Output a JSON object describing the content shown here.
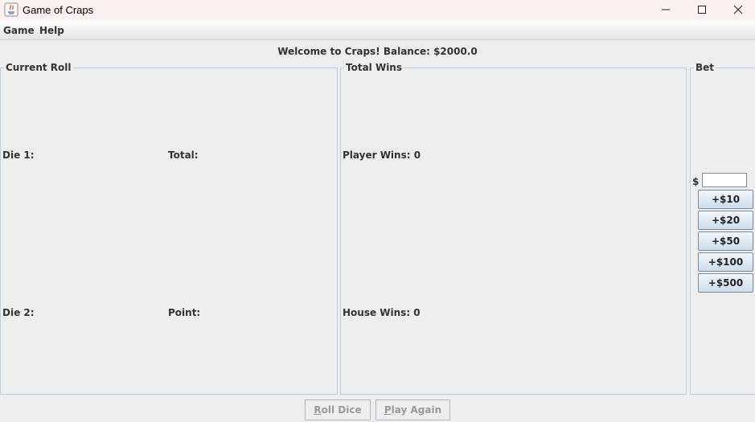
{
  "window": {
    "title": "Game of Craps",
    "icon": "java-icon"
  },
  "menu": {
    "items": [
      "Game",
      "Help"
    ]
  },
  "status": {
    "welcome": "Welcome to Craps!  Balance: $2000.0"
  },
  "current_roll": {
    "title": "Current Roll",
    "die1_label": "Die 1:",
    "die2_label": "Die 2:",
    "total_label": "Total:",
    "point_label": "Point:"
  },
  "total_wins": {
    "title": "Total Wins",
    "player_wins": "Player Wins: 0",
    "house_wins": "House Wins: 0"
  },
  "bet": {
    "title": "Bet",
    "currency": "$",
    "value": "",
    "amounts": [
      "+$10",
      "+$20",
      "+$50",
      "+$100",
      "+$500"
    ]
  },
  "actions": {
    "roll_first": "R",
    "roll_rest": "oll Dice",
    "play_first": "P",
    "play_rest": "lay Again"
  }
}
